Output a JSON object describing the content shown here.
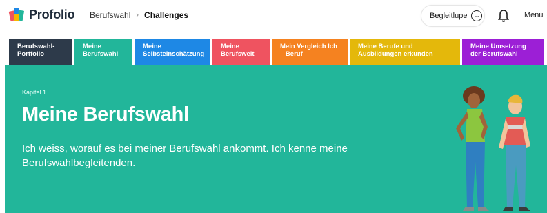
{
  "app": {
    "name": "Profolio"
  },
  "breadcrumb": {
    "parent": "Berufswahl",
    "separator": "›",
    "current": "Challenges"
  },
  "header": {
    "begleitlupe_label": "Begleitlupe",
    "menu_label": "Menu"
  },
  "tabs": [
    {
      "label": "Berufswahl-Portfolio",
      "color": "#2d3a4a"
    },
    {
      "label": "Meine Berufswahl",
      "color": "#22b69a"
    },
    {
      "label": "Meine Selbsteinschätzung",
      "color": "#1e88e5"
    },
    {
      "label": "Meine Berufswelt",
      "color": "#ef5360"
    },
    {
      "label": "Mein Vergleich Ich – Beruf",
      "color": "#f58220"
    },
    {
      "label": "Meine Berufe und Ausbildungen erkunden",
      "color": "#e4b80b"
    },
    {
      "label": "Meine Umsetzung der Berufswahl",
      "color": "#9c1fd6"
    }
  ],
  "hero": {
    "kicker": "Kapitel 1",
    "title": "Meine Berufswahl",
    "text": "Ich weiss, worauf es bei meiner Berufswahl ankommt. Ich kenne meine Berufswahlbegleitenden.",
    "background": "#22b69a"
  },
  "icons": [
    "profolio-logo-icon",
    "chevron-right-icon",
    "ellipsis-circle-icon",
    "bell-icon",
    "kebab-menu-icon"
  ]
}
